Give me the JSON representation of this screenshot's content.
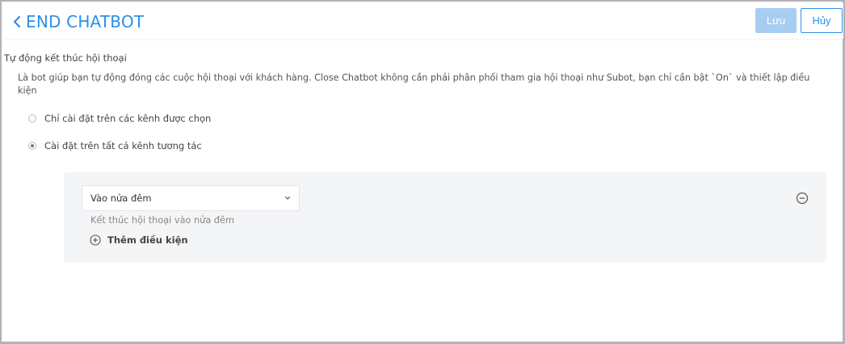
{
  "header": {
    "title": "END CHATBOT",
    "save_label": "Lưu",
    "cancel_label": "Hủy"
  },
  "section": {
    "title": "Tự động kết thúc hội thoại",
    "description": "Là bot giúp bạn tự động đóng các cuộc hội thoại với khách hàng. Close Chatbot không cần phải phân phối tham gia hội thoại như Subot, bạn chỉ cần bật `On` và thiết lập điều kiện"
  },
  "options": [
    {
      "label": "Chỉ cài đặt trên các kênh được chọn",
      "checked": false
    },
    {
      "label": "Cài đặt trên tất cả kênh tương tác",
      "checked": true
    }
  ],
  "condition": {
    "selected": "Vào nửa đêm",
    "description": "Kết thúc hội thoại vào nửa đêm",
    "add_label": "Thêm điều kiện"
  },
  "colors": {
    "accent": "#2d8fe8",
    "save_disabled": "#a8cdf2",
    "panel_bg": "#f4f5f7"
  },
  "icons": {
    "back": "chevron-left-icon",
    "dropdown": "chevron-down-icon",
    "add": "plus-circle-icon",
    "remove": "minus-circle-icon"
  }
}
